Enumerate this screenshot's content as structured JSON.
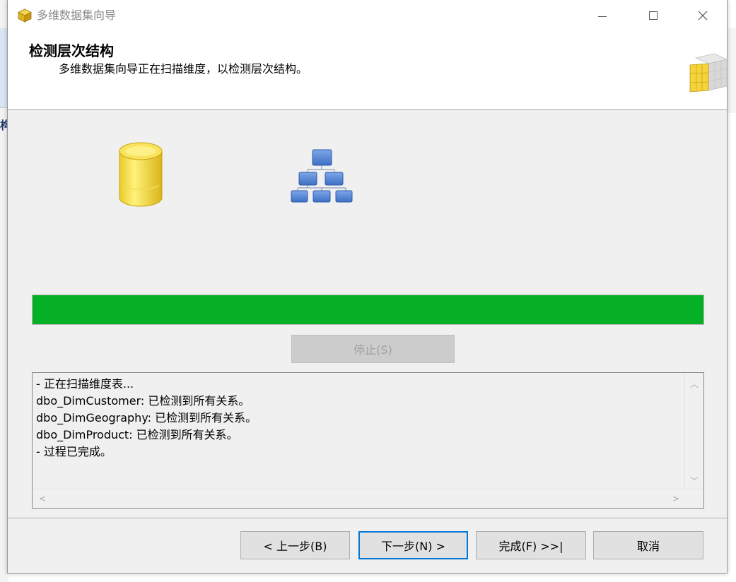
{
  "window": {
    "title": "多维数据集向导",
    "icon": "cube-icon"
  },
  "header": {
    "title": "检测层次结构",
    "subtitle": "多维数据集向导正在扫描维度，以检测层次结构。",
    "icon": "cube-grid-icon"
  },
  "body": {
    "source_icon": "database-icon",
    "target_icon": "hierarchy-icon",
    "progress": 1.0,
    "progress_color": "#06b025",
    "stop_label": "停止(S)"
  },
  "log": {
    "lines": [
      "- 正在扫描维度表...",
      "dbo_DimCustomer: 已检测到所有关系。",
      "dbo_DimGeography: 已检测到所有关系。",
      "dbo_DimProduct: 已检测到所有关系。",
      "- 过程已完成。"
    ]
  },
  "footer": {
    "back_label": "< 上一步(B)",
    "next_label": "下一步(N) >",
    "finish_label": "完成(F) >>|",
    "cancel_label": "取消"
  },
  "colors": {
    "accent": "#0078d7",
    "progress": "#06b025"
  }
}
